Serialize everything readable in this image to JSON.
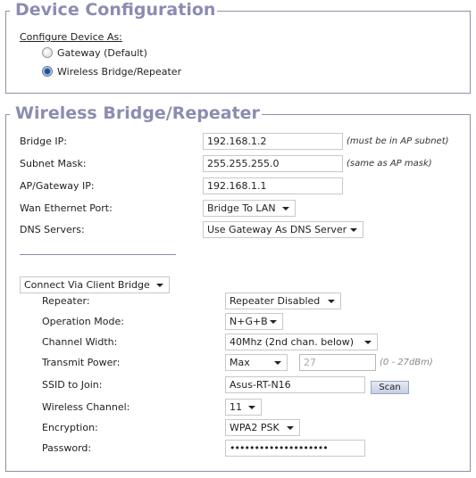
{
  "device_config": {
    "legend": "Device Configuration",
    "configure_label": "Configure Device As:",
    "options": [
      {
        "label": "Gateway (Default)",
        "checked": false
      },
      {
        "label": "Wireless Bridge/Repeater",
        "checked": true
      }
    ]
  },
  "bridge": {
    "legend": "Wireless Bridge/Repeater",
    "bridge_ip": {
      "label": "Bridge IP:",
      "value": "192.168.1.2",
      "hint": "(must be in AP subnet)"
    },
    "subnet_mask": {
      "label": "Subnet Mask:",
      "value": "255.255.255.0",
      "hint": "(same as AP mask)"
    },
    "gateway_ip": {
      "label": "AP/Gateway IP:",
      "value": "192.168.1.1"
    },
    "wan_port": {
      "label": "Wan Ethernet Port:",
      "value": "Bridge To LAN"
    },
    "dns": {
      "label": "DNS Servers:",
      "value": "Use Gateway As DNS Server"
    },
    "connect_mode": {
      "value": "Connect Via Client Bridge"
    },
    "repeater": {
      "label": "Repeater:",
      "value": "Repeater Disabled"
    },
    "op_mode": {
      "label": "Operation Mode:",
      "value": "N+G+B"
    },
    "channel_width": {
      "label": "Channel Width:",
      "value": "40Mhz (2nd chan. below)"
    },
    "tx_power": {
      "label": "Transmit Power:",
      "value": "Max",
      "power_value": "27",
      "hint": "(0 - 27dBm)"
    },
    "ssid": {
      "label": "SSID to Join:",
      "value": "Asus-RT-N16",
      "scan_label": "Scan"
    },
    "channel": {
      "label": "Wireless Channel:",
      "value": "11"
    },
    "encryption": {
      "label": "Encryption:",
      "value": "WPA2 PSK"
    },
    "password": {
      "label": "Password:",
      "value": "••••••••••••••••••••"
    }
  }
}
